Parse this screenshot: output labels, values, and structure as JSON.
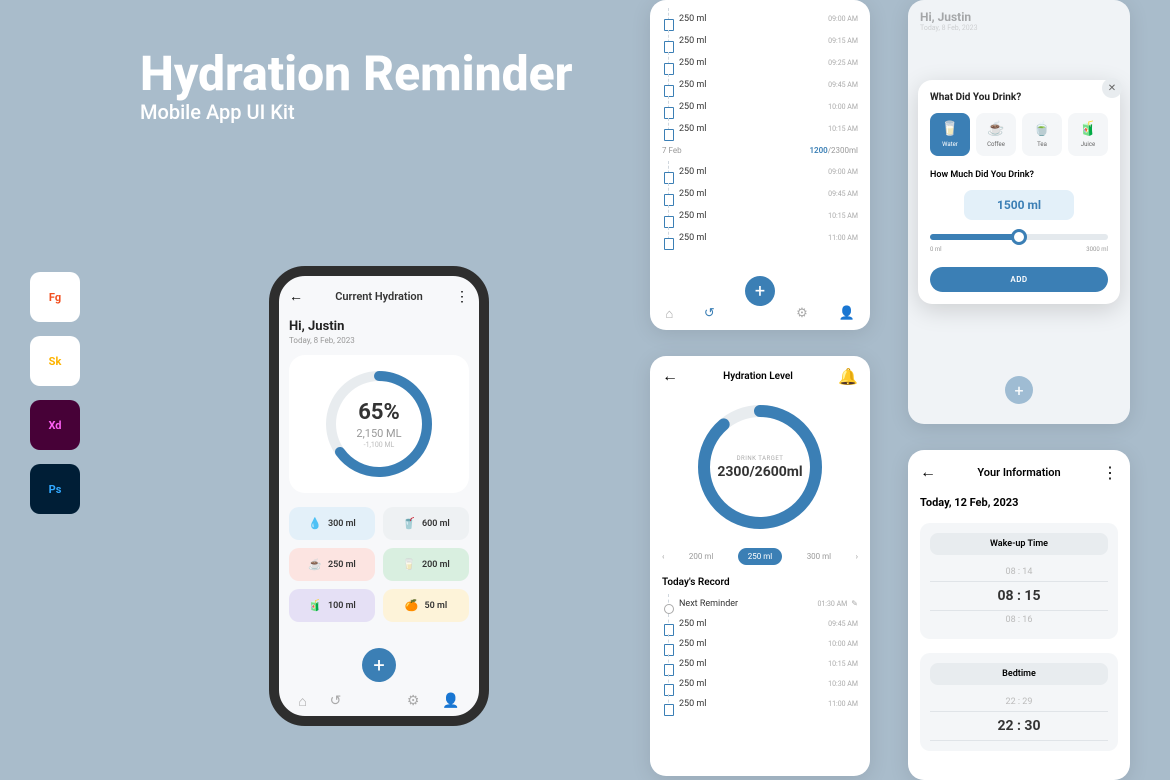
{
  "hero": {
    "title": "Hydration Reminder",
    "subtitle": "Mobile App UI Kit"
  },
  "tools": [
    "Fg",
    "Sk",
    "Xd",
    "Ps"
  ],
  "phone": {
    "title": "Current Hydration",
    "greeting": "Hi, Justin",
    "date": "Today, 8 Feb, 2023",
    "percent": "65%",
    "amount": "2,150 ML",
    "remaining": "-1,100 ML",
    "quick": [
      "300 ml",
      "600 ml",
      "250 ml",
      "200 ml",
      "100 ml",
      "50 ml"
    ]
  },
  "log": {
    "items1": [
      {
        "amt": "250 ml",
        "time": "09:00 AM"
      },
      {
        "amt": "250 ml",
        "time": "09:15 AM"
      },
      {
        "amt": "250 ml",
        "time": "09:25 AM"
      },
      {
        "amt": "250 ml",
        "time": "09:45 AM"
      },
      {
        "amt": "250 ml",
        "time": "10:00 AM"
      },
      {
        "amt": "250 ml",
        "time": "10:15 AM"
      }
    ],
    "date": "7 Feb",
    "total": "1200",
    "target": "/2300ml",
    "items2": [
      {
        "amt": "250 ml",
        "time": "09:00 AM"
      },
      {
        "amt": "250 ml",
        "time": "09:45 AM"
      },
      {
        "amt": "250 ml",
        "time": "10:15 AM"
      },
      {
        "amt": "250 ml",
        "time": "11:00 AM"
      }
    ]
  },
  "level": {
    "title": "Hydration Level",
    "label": "DRINK TARGET",
    "value": "2300/2600ml",
    "opts": [
      "200 ml",
      "250 ml",
      "300 ml"
    ],
    "section": "Today's Record",
    "reminder": {
      "label": "Next Reminder",
      "time": "01:30 AM"
    },
    "records": [
      {
        "amt": "250 ml",
        "time": "09:45 AM"
      },
      {
        "amt": "250 ml",
        "time": "10:00 AM"
      },
      {
        "amt": "250 ml",
        "time": "10:15 AM"
      },
      {
        "amt": "250 ml",
        "time": "10:30 AM"
      },
      {
        "amt": "250 ml",
        "time": "11:00 AM"
      }
    ]
  },
  "modal": {
    "bg_name": "Hi, Justin",
    "bg_date": "Today, 8 Feb, 2023",
    "q1": "What Did You Drink?",
    "drinks": [
      "Water",
      "Coffee",
      "Tea",
      "Juice"
    ],
    "q2": "How Much Did You Drink?",
    "amount": "1500 ml",
    "min": "0 ml",
    "max": "3000 ml",
    "btn": "ADD"
  },
  "info": {
    "title": "Your Information",
    "date": "Today, 12 Feb, 2023",
    "wake": {
      "title": "Wake-up Time",
      "rows": [
        "08   :   14",
        "08   :   15",
        "08   :   16"
      ]
    },
    "bed": {
      "title": "Bedtime",
      "rows": [
        "22   :   29",
        "22   :   30"
      ]
    }
  }
}
